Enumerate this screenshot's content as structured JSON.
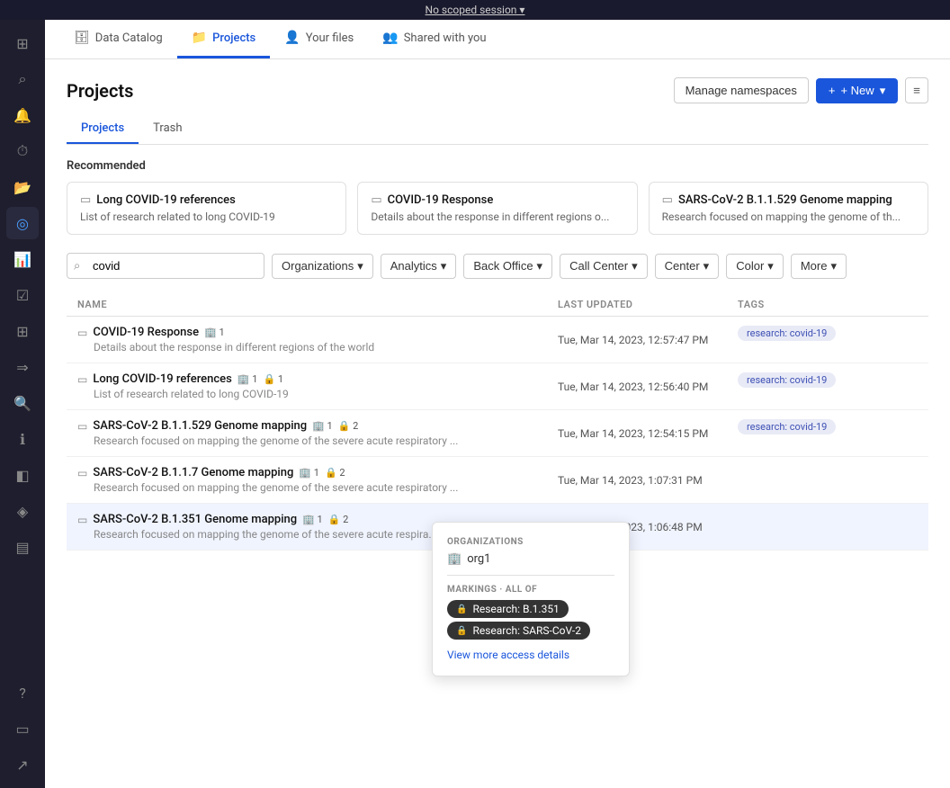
{
  "topBar": {
    "text": "No scoped session ▾"
  },
  "navTabs": [
    {
      "id": "data-catalog",
      "label": "Data Catalog",
      "icon": "🗄",
      "active": false
    },
    {
      "id": "projects",
      "label": "Projects",
      "icon": "📁",
      "active": true
    },
    {
      "id": "your-files",
      "label": "Your files",
      "icon": "👤",
      "active": false
    },
    {
      "id": "shared-with-you",
      "label": "Shared with you",
      "icon": "👥",
      "active": false
    }
  ],
  "sidebar": {
    "icons": [
      {
        "id": "home",
        "symbol": "⊞",
        "active": false
      },
      {
        "id": "search",
        "symbol": "⌕",
        "active": false
      },
      {
        "id": "bell",
        "symbol": "🔔",
        "active": false
      },
      {
        "id": "clock",
        "symbol": "⏱",
        "active": false
      },
      {
        "id": "folder",
        "symbol": "📂",
        "active": false
      },
      {
        "id": "compass",
        "symbol": "◎",
        "active": true
      },
      {
        "id": "chart",
        "symbol": "📊",
        "active": false
      },
      {
        "id": "checklist",
        "symbol": "☑",
        "active": false
      },
      {
        "id": "grid",
        "symbol": "⊞",
        "active": false
      },
      {
        "id": "plus-arrow",
        "symbol": "⇒",
        "active": false
      },
      {
        "id": "magnify",
        "symbol": "🔍",
        "active": false
      },
      {
        "id": "info-circle",
        "symbol": "ℹ",
        "active": false
      },
      {
        "id": "layers",
        "symbol": "◧",
        "active": false
      },
      {
        "id": "cube",
        "symbol": "◈",
        "active": false
      },
      {
        "id": "stack",
        "symbol": "≡",
        "active": false
      },
      {
        "id": "question",
        "symbol": "?",
        "active": false
      },
      {
        "id": "rect",
        "symbol": "▭",
        "active": false
      },
      {
        "id": "arrow-up-right",
        "symbol": "↗",
        "active": false
      }
    ]
  },
  "page": {
    "title": "Projects",
    "subTabs": [
      {
        "id": "projects",
        "label": "Projects",
        "active": true
      },
      {
        "id": "trash",
        "label": "Trash",
        "active": false
      }
    ],
    "manageBtn": "Manage namespaces",
    "newBtn": "+ New",
    "recommended": {
      "title": "Recommended",
      "cards": [
        {
          "id": "long-covid",
          "icon": "▭",
          "title": "Long COVID-19 references",
          "desc": "List of research related to long COVID-19"
        },
        {
          "id": "covid-response",
          "icon": "▭",
          "title": "COVID-19 Response",
          "desc": "Details about the response in different regions o..."
        },
        {
          "id": "sars-genome",
          "icon": "▭",
          "title": "SARS-CoV-2 B.1.1.529 Genome mapping",
          "desc": "Research focused on mapping the genome of th..."
        }
      ]
    },
    "filters": {
      "searchValue": "covid",
      "searchPlaceholder": "Search",
      "buttons": [
        {
          "id": "organizations",
          "label": "Organizations"
        },
        {
          "id": "analytics",
          "label": "Analytics"
        },
        {
          "id": "back-office",
          "label": "Back Office"
        },
        {
          "id": "call-center",
          "label": "Call Center"
        },
        {
          "id": "center",
          "label": "Center"
        },
        {
          "id": "color",
          "label": "Color"
        },
        {
          "id": "more",
          "label": "More"
        }
      ]
    },
    "table": {
      "columns": [
        {
          "id": "name",
          "label": "NAME"
        },
        {
          "id": "last-updated",
          "label": "LAST UPDATED"
        },
        {
          "id": "tags",
          "label": "TAGS"
        }
      ],
      "rows": [
        {
          "id": "covid-response",
          "icon": "▭",
          "name": "COVID-19 Response",
          "desc": "Details about the response in different regions of the world",
          "orgs": "1",
          "markings": null,
          "date": "Tue, Mar 14, 2023, 12:57:47 PM",
          "tag": "research: covid-19"
        },
        {
          "id": "long-covid-ref",
          "icon": "▭",
          "name": "Long COVID-19 references",
          "desc": "List of research related to long COVID-19",
          "orgs": "1",
          "markings": "1",
          "date": "Tue, Mar 14, 2023, 12:56:40 PM",
          "tag": "research: covid-19"
        },
        {
          "id": "sars-b11529",
          "icon": "▭",
          "name": "SARS-CoV-2 B.1.1.529 Genome mapping",
          "desc": "Research focused on mapping the genome of the severe acute respiratory ...",
          "orgs": "1",
          "markings": "2",
          "date": "Tue, Mar 14, 2023, 12:54:15 PM",
          "tag": "research: covid-19"
        },
        {
          "id": "sars-b117",
          "icon": "▭",
          "name": "SARS-CoV-2 B.1.1.7 Genome mapping",
          "desc": "Research focused on mapping the genome of the severe acute respiratory ...",
          "orgs": "1",
          "markings": "2",
          "date": "Tue, Mar 14, 2023, 1:07:31 PM",
          "tag": ""
        },
        {
          "id": "sars-b1351",
          "icon": "▭",
          "name": "SARS-CoV-2 B.1.351 Genome mapping",
          "desc": "Research focused on mapping the genome of the severe acute respira...",
          "orgs": "1",
          "markings": "2",
          "date": "Tue, Mar 14, 2023, 1:06:48 PM",
          "tag": ""
        }
      ]
    },
    "tooltip": {
      "orgsSectionTitle": "ORGANIZATIONS",
      "orgName": "org1",
      "markingsSectionTitle": "MARKINGS · All of",
      "markings": [
        {
          "id": "b1351",
          "label": "Research: B.1.351"
        },
        {
          "id": "sars-cov2",
          "label": "Research: SARS-CoV-2"
        }
      ],
      "link": "View more access details"
    }
  }
}
